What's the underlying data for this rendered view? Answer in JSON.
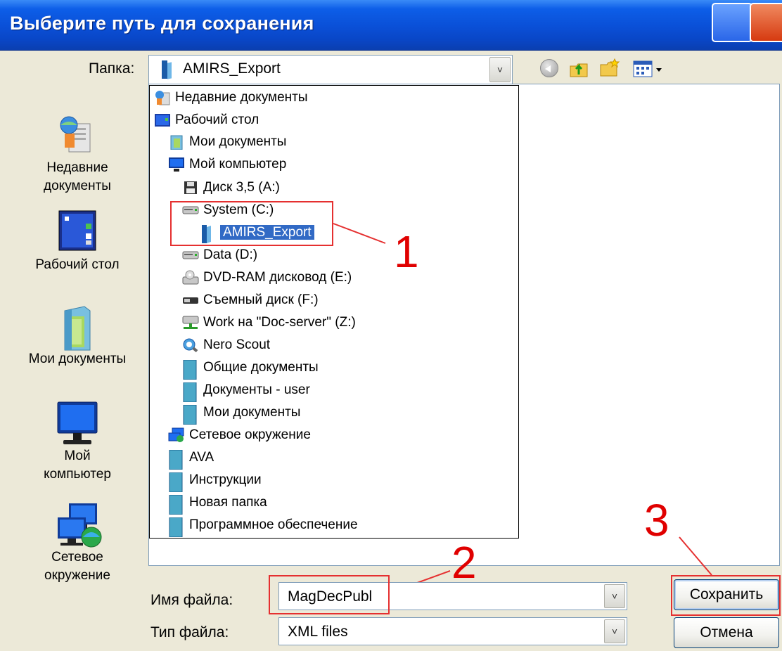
{
  "window": {
    "title": "Выберите путь для сохранения"
  },
  "folder": {
    "label": "Папка:",
    "current": "AMIRS_Export"
  },
  "toolbar": {
    "icons": [
      "back-icon",
      "up-folder-icon",
      "new-folder-icon",
      "view-menu-icon"
    ]
  },
  "places": [
    {
      "label": "Недавние документы",
      "icon": "recent-documents-icon"
    },
    {
      "label": "Рабочий стол",
      "icon": "desktop-icon"
    },
    {
      "label": "Мои документы",
      "icon": "my-documents-icon"
    },
    {
      "label": "Мой компьютер",
      "icon": "my-computer-icon"
    },
    {
      "label": "Сетевое окружение",
      "icon": "network-icon"
    }
  ],
  "dropdown": {
    "items": [
      {
        "label": "Недавние документы",
        "icon": "recent-documents-icon"
      },
      {
        "label": "Рабочий стол",
        "icon": "desktop-icon"
      },
      {
        "label": "Мои документы",
        "icon": "my-documents-icon"
      },
      {
        "label": "Мой компьютер",
        "icon": "my-computer-icon"
      },
      {
        "label": "Диск 3,5 (A:)",
        "icon": "floppy-icon"
      },
      {
        "label": "System (C:)",
        "icon": "hard-drive-icon"
      },
      {
        "label": "AMIRS_Export",
        "icon": "folder-icon",
        "selected": true
      },
      {
        "label": "Data (D:)",
        "icon": "hard-drive-icon"
      },
      {
        "label": "DVD-RAM дисковод (E:)",
        "icon": "dvd-drive-icon"
      },
      {
        "label": "Съемный диск (F:)",
        "icon": "removable-disk-icon"
      },
      {
        "label": "Work на \"Doc-server\" (Z:)",
        "icon": "network-drive-icon"
      },
      {
        "label": "Nero Scout",
        "icon": "nero-scout-icon"
      },
      {
        "label": "Общие документы",
        "icon": "folder-icon"
      },
      {
        "label": "Документы - user",
        "icon": "folder-icon"
      },
      {
        "label": "Мои документы",
        "icon": "folder-icon"
      },
      {
        "label": "Сетевое окружение",
        "icon": "network-icon"
      },
      {
        "label": "AVA",
        "icon": "folder-icon"
      },
      {
        "label": "Инструкции",
        "icon": "folder-icon"
      },
      {
        "label": "Новая папка",
        "icon": "folder-icon"
      },
      {
        "label": "Программное обеспечение",
        "icon": "folder-icon"
      }
    ]
  },
  "filename": {
    "label": "Имя файла:",
    "value": "MagDecPubl"
  },
  "filetype": {
    "label": "Тип файла:",
    "value": "XML files"
  },
  "buttons": {
    "save": "Сохранить",
    "cancel": "Отмена"
  },
  "annotations": [
    "1",
    "2",
    "3"
  ],
  "colors": {
    "title_bar": "#0a4fd6",
    "selection": "#316ac5",
    "annotation": "#e53030"
  }
}
